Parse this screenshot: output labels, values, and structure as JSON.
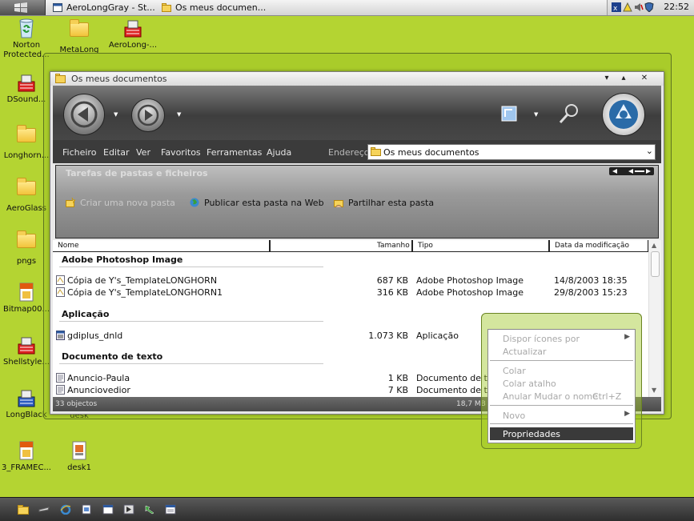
{
  "taskbar": {
    "tasks": [
      {
        "label": "AeroLongGray - St..."
      },
      {
        "label": "Os meus documen..."
      }
    ],
    "clock": "22:52"
  },
  "desktop_icons": [
    {
      "label": "Norton Protected...",
      "line1": "Norton",
      "line2": "Protected..."
    },
    {
      "label": "MetaLong"
    },
    {
      "label": "AeroLong-..."
    },
    {
      "label": "DSound..."
    },
    {
      "label": "Longhorn..."
    },
    {
      "label": "AeroGlass"
    },
    {
      "label": "pngs"
    },
    {
      "label": "Bitmap00..."
    },
    {
      "label": "Shellstyle..."
    },
    {
      "label": "LongBlack"
    },
    {
      "label": "desk"
    },
    {
      "label": "3_FRAMEC..."
    },
    {
      "label": "desk1"
    }
  ],
  "window": {
    "title": "Os meus documentos",
    "controls": {
      "minimize": "▾",
      "maximize": "▴",
      "close": "✕"
    },
    "menu": [
      "Ficheiro",
      "Editar",
      "Ver",
      "Favoritos",
      "Ferramentas",
      "Ajuda"
    ],
    "address_label": "Endereço",
    "address_value": "Os meus documentos",
    "tasks_panel": {
      "title": "Tarefas de pastas e ficheiros",
      "links": [
        "Criar uma nova pasta",
        "Publicar esta pasta na Web",
        "Partilhar esta pasta"
      ]
    },
    "columns": [
      "Nome",
      "Tamanho",
      "Tipo",
      "Data da modificação"
    ],
    "groups": [
      {
        "title": "Adobe Photoshop Image",
        "files": [
          {
            "name": "Cópia de Y's_TemplateLONGHORN",
            "size": "687 KB",
            "type": "Adobe Photoshop Image",
            "date": "14/8/2003 18:35"
          },
          {
            "name": "Cópia de Y's_TemplateLONGHORN1",
            "size": "316 KB",
            "type": "Adobe Photoshop Image",
            "date": "29/8/2003 15:23"
          }
        ]
      },
      {
        "title": "Aplicação",
        "files": [
          {
            "name": "gdiplus_dnld",
            "size": "1.073 KB",
            "type": "Aplicação",
            "date": ""
          }
        ]
      },
      {
        "title": "Documento de texto",
        "files": [
          {
            "name": "Anuncio-Paula",
            "size": "1 KB",
            "type": "Documento de texto",
            "date": ""
          },
          {
            "name": "Anunciovedior",
            "size": "7 KB",
            "type": "Documento de texto",
            "date": ""
          }
        ]
      }
    ],
    "status": {
      "count": "33 objectos",
      "size": "18,7 MB"
    }
  },
  "context_menu": {
    "items": [
      {
        "label": "Dispor ícones por",
        "enabled": false,
        "submenu": true
      },
      {
        "label": "Actualizar",
        "enabled": false
      },
      {
        "label": "Colar",
        "enabled": false
      },
      {
        "label": "Colar atalho",
        "enabled": false
      },
      {
        "label": "Anular Mudar o nome",
        "shortcut": "Ctrl+Z",
        "enabled": false
      },
      {
        "label": "Novo",
        "enabled": false,
        "submenu": true
      },
      {
        "label": "Propriedades",
        "enabled": true,
        "selected": true
      }
    ]
  },
  "colors": {
    "desktop": "#b4d432",
    "accent": "#3a3a3a"
  }
}
